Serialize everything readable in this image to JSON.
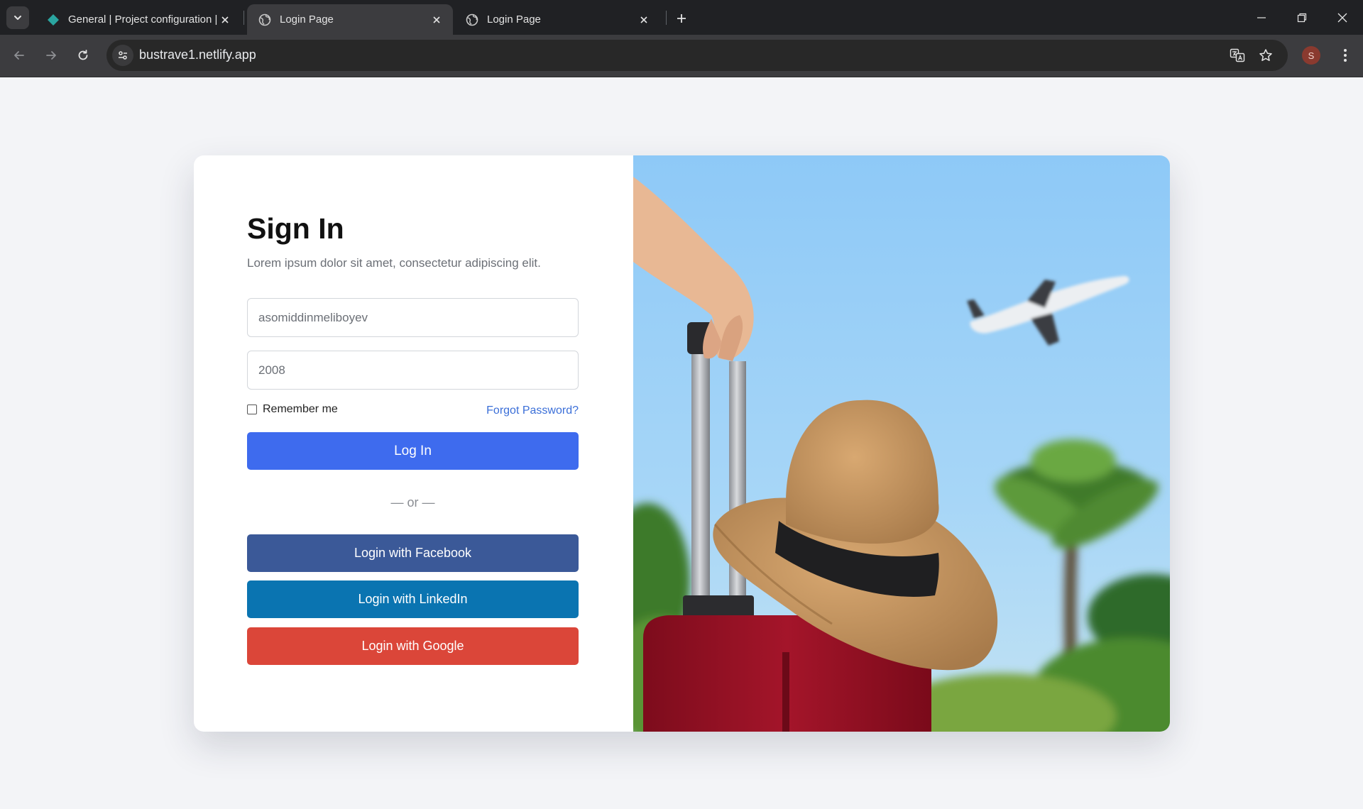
{
  "browser": {
    "tabs": [
      {
        "title": "General | Project configuration |",
        "active": false
      },
      {
        "title": "Login Page",
        "active": true
      },
      {
        "title": "Login Page",
        "active": false
      }
    ],
    "url": "bustrave1.netlify.app",
    "profile_initial": "S",
    "accent": "#2a9d8f"
  },
  "login": {
    "title": "Sign In",
    "subtitle": "Lorem ipsum dolor sit amet, consectetur adipiscing elit.",
    "username_value": "asomiddinmeliboyev",
    "password_value": "2008",
    "remember_label": "Remember me",
    "remember_checked": false,
    "forgot_label": "Forgot Password?",
    "login_button": "Log In",
    "divider_text": "— or —",
    "social": {
      "facebook": "Login with Facebook",
      "linkedin": "Login with LinkedIn",
      "google": "Login with Google"
    }
  },
  "colors": {
    "primary": "#3e6bee",
    "facebook": "#3b5998",
    "linkedin": "#0a74b1",
    "google": "#db4639",
    "link": "#3b6fd8"
  },
  "hero_icons": [
    "airplane-icon",
    "palm-tree-icon",
    "suitcase-icon",
    "straw-hat-icon"
  ]
}
